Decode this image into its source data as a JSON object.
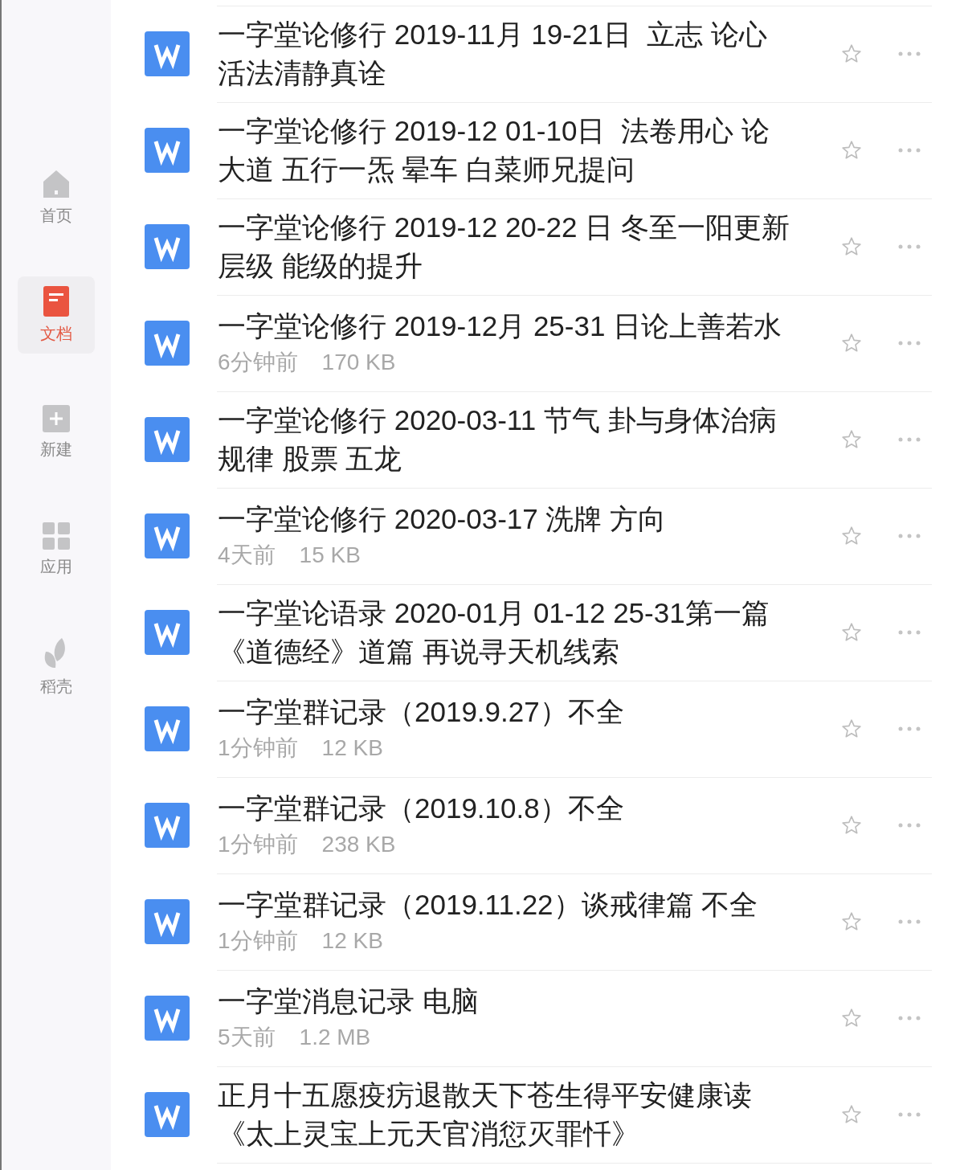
{
  "sidebar": {
    "items": [
      {
        "label": "首页",
        "selected": false
      },
      {
        "label": "文档",
        "selected": true
      },
      {
        "label": "新建",
        "selected": false
      },
      {
        "label": "应用",
        "selected": false
      },
      {
        "label": "稻壳",
        "selected": false
      }
    ]
  },
  "files": [
    {
      "title": "一字堂论修行 2019-11月 19-21日  立志 论心活法清静真诠",
      "starred": false
    },
    {
      "title": "一字堂论修行 2019-12 01-10日  法卷用心 论大道 五行一炁 晕车 白菜师兄提问",
      "starred": false
    },
    {
      "title": "一字堂论修行 2019-12 20-22 日 冬至一阳更新层级 能级的提升",
      "starred": false
    },
    {
      "title": "一字堂论修行 2019-12月 25-31 日论上善若水",
      "time": "6分钟前",
      "size": "170 KB",
      "starred": false
    },
    {
      "title": "一字堂论修行 2020-03-11 节气 卦与身体治病规律 股票 五龙",
      "starred": false
    },
    {
      "title": "一字堂论修行 2020-03-17 洗牌 方向",
      "time": "4天前",
      "size": "15 KB",
      "starred": false
    },
    {
      "title": "一字堂论语录 2020-01月 01-12 25-31第一篇《道德经》道篇 再说寻天机线索",
      "starred": false
    },
    {
      "title": "一字堂群记录（2019.9.27）不全",
      "time": "1分钟前",
      "size": "12 KB",
      "starred": false
    },
    {
      "title": "一字堂群记录（2019.10.8）不全",
      "time": "1分钟前",
      "size": "238 KB",
      "starred": false
    },
    {
      "title": "一字堂群记录（2019.11.22）谈戒律篇 不全",
      "time": "1分钟前",
      "size": "12 KB",
      "starred": false
    },
    {
      "title": "一字堂消息记录 电脑",
      "time": "5天前",
      "size": "1.2 MB",
      "starred": false
    },
    {
      "title": "正月十五愿疫疠退散天下苍生得平安健康读《太上灵宝上元天官消愆灭罪忏》",
      "starred": false
    }
  ]
}
